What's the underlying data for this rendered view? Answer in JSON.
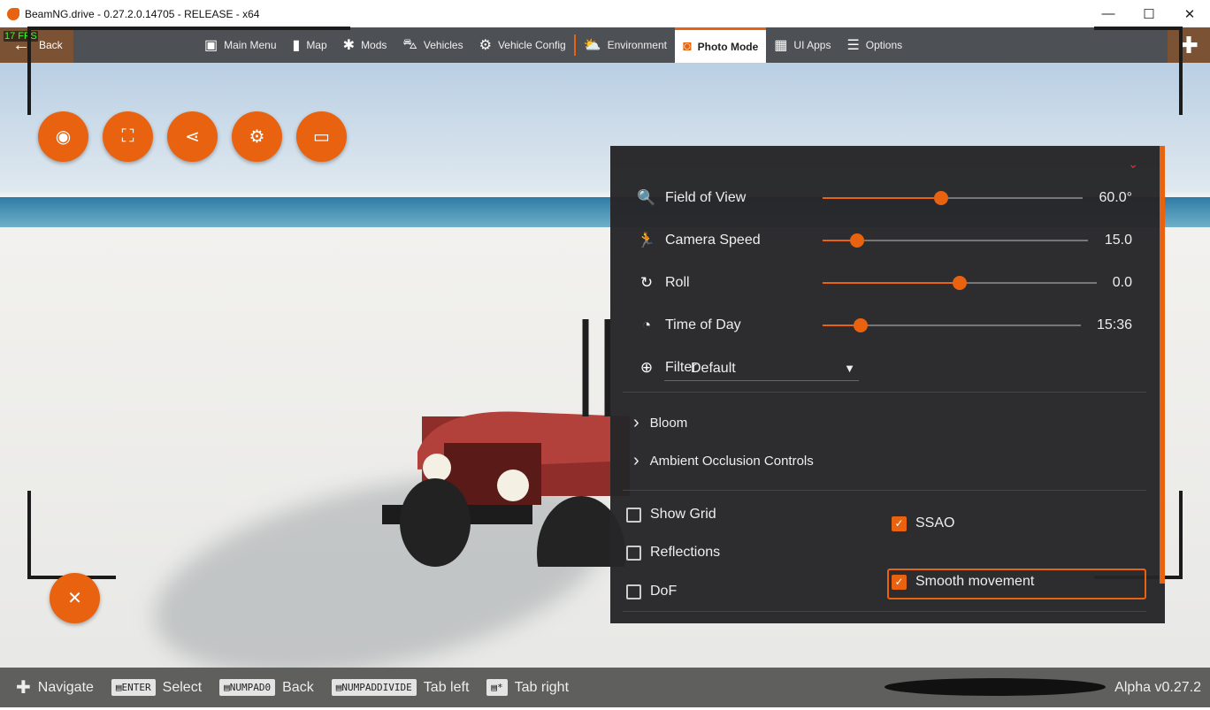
{
  "window": {
    "title": "BeamNG.drive - 0.27.2.0.14705 - RELEASE - x64",
    "minimize": "—",
    "maximize": "☐",
    "close": "✕"
  },
  "nav": {
    "fps": "17 FPS",
    "back": "Back",
    "items": [
      {
        "label": "Main Menu",
        "icon": "▣"
      },
      {
        "label": "Map",
        "icon": "▮"
      },
      {
        "label": "Mods",
        "icon": "✱"
      },
      {
        "label": "Vehicles",
        "icon": "⛍"
      },
      {
        "label": "Vehicle Config",
        "icon": "⚙"
      },
      {
        "label": "Environment",
        "icon": "⛅"
      },
      {
        "label": "Photo Mode",
        "icon": "◙"
      },
      {
        "label": "UI Apps",
        "icon": "▦"
      },
      {
        "label": "Options",
        "icon": "☰"
      }
    ],
    "plus": "✚"
  },
  "tools": [
    {
      "name": "camera",
      "icon": "◉"
    },
    {
      "name": "fullscreen",
      "icon": "⛶"
    },
    {
      "name": "share",
      "icon": "⋖"
    },
    {
      "name": "steam",
      "icon": "⚙"
    },
    {
      "name": "folder",
      "icon": "▭"
    }
  ],
  "close_icon": "✕",
  "panel": {
    "collapse": "⌄",
    "sliders": [
      {
        "label": "Field of View",
        "icon": "🔍",
        "value": "60.0°",
        "fraction": 0.456
      },
      {
        "label": "Camera Speed",
        "icon": "🏃",
        "value": "15.0",
        "fraction": 0.13
      },
      {
        "label": "Roll",
        "icon": "↻",
        "value": "0.0",
        "fraction": 0.5
      },
      {
        "label": "Time of Day",
        "icon": "◔",
        "value": "15:36",
        "fraction": 0.147
      }
    ],
    "filter": {
      "label": "Filter",
      "icon": "⊕",
      "value": "Default",
      "arrow": "▼"
    },
    "sections": [
      {
        "label": "Bloom",
        "chevron": "›"
      },
      {
        "label": "Ambient Occlusion Controls",
        "chevron": "›"
      }
    ],
    "checkboxes": [
      {
        "label": "Show Grid",
        "checked": false
      },
      {
        "label": "Reflections",
        "checked": false
      },
      {
        "label": "DoF",
        "checked": false
      },
      {
        "label": "SSAO",
        "checked": true
      },
      {
        "label": "Smooth movement",
        "checked": true
      }
    ],
    "check": "✓"
  },
  "footer": {
    "hints": [
      {
        "key": "",
        "label": "Navigate",
        "icon": "✚"
      },
      {
        "key": "ENTER",
        "label": "Select"
      },
      {
        "key": "NUMPAD0",
        "label": "Back"
      },
      {
        "key": "NUMPADDIVIDE",
        "label": "Tab left"
      },
      {
        "key": "*",
        "label": "Tab right"
      }
    ],
    "version": "Alpha v0.27.2"
  }
}
